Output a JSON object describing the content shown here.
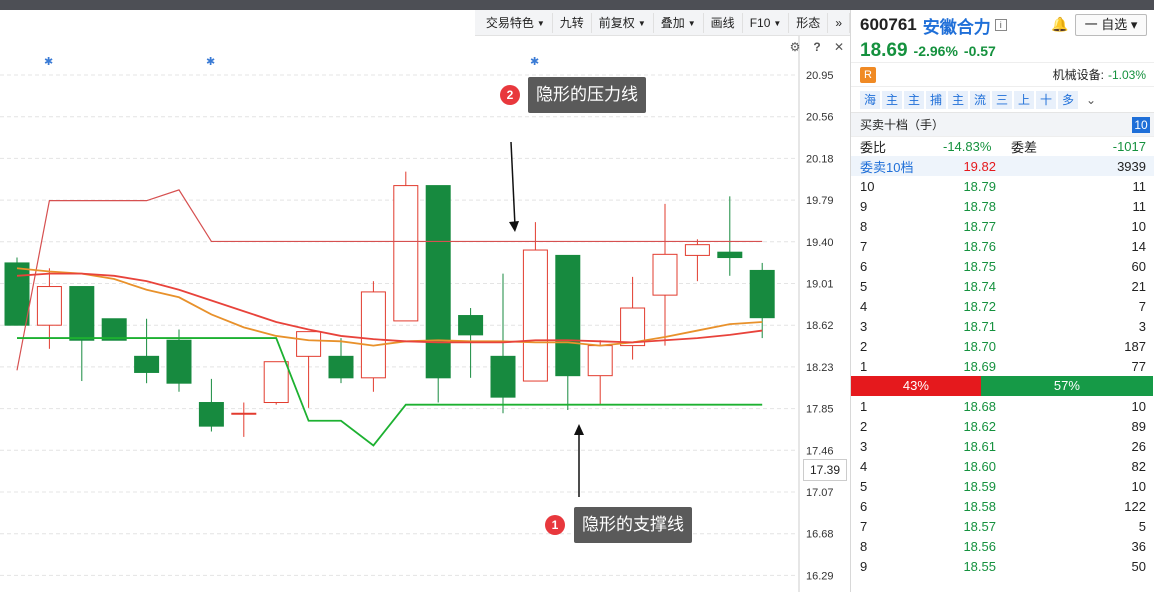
{
  "toolbar": {
    "items": [
      {
        "label": "交易特色",
        "caret": true
      },
      {
        "label": "九转",
        "caret": false
      },
      {
        "label": "前复权",
        "caret": true
      },
      {
        "label": "叠加",
        "caret": true
      },
      {
        "label": "画线",
        "caret": false
      },
      {
        "label": "F10",
        "caret": true
      },
      {
        "label": "形态",
        "caret": false
      },
      {
        "label": "»",
        "caret": false
      }
    ]
  },
  "chart": {
    "y_ticks": [
      "20.95",
      "20.56",
      "20.18",
      "19.79",
      "19.40",
      "19.01",
      "18.62",
      "18.23",
      "17.85",
      "17.46",
      "17.07",
      "16.68",
      "16.29"
    ],
    "current_price_tag": "17.39",
    "callout_resistance": "隐形的压力线",
    "callout_support": "隐形的支撑线",
    "badge_resistance": "2",
    "badge_support": "1",
    "icons": [
      "gear-icon",
      "help-icon",
      "close-icon"
    ],
    "colors": {
      "up": "#e23b2e",
      "down": "#178a3f",
      "ma_orange": "#e8912b",
      "ma_red": "#e8433b",
      "support": "#1db131",
      "resistance": "#d65050"
    }
  },
  "chart_data": {
    "type": "candlestick",
    "candles": [
      {
        "o": 19.2,
        "h": 19.25,
        "l": 18.62,
        "c": 18.62
      },
      {
        "o": 18.62,
        "h": 19.15,
        "l": 18.4,
        "c": 18.98
      },
      {
        "o": 18.98,
        "h": 18.98,
        "l": 18.1,
        "c": 18.48
      },
      {
        "o": 18.68,
        "h": 18.68,
        "l": 18.5,
        "c": 18.48
      },
      {
        "o": 18.33,
        "h": 18.68,
        "l": 18.08,
        "c": 18.18
      },
      {
        "o": 18.48,
        "h": 18.58,
        "l": 18.0,
        "c": 18.08
      },
      {
        "o": 17.9,
        "h": 18.12,
        "l": 17.63,
        "c": 17.68
      },
      {
        "o": 17.8,
        "h": 17.9,
        "l": 17.58,
        "c": 17.8
      },
      {
        "o": 17.9,
        "h": 18.12,
        "l": 17.88,
        "c": 18.28
      },
      {
        "o": 18.33,
        "h": 18.56,
        "l": 17.85,
        "c": 18.56
      },
      {
        "o": 18.33,
        "h": 18.5,
        "l": 18.08,
        "c": 18.13
      },
      {
        "o": 18.13,
        "h": 19.03,
        "l": 18.0,
        "c": 18.93
      },
      {
        "o": 18.66,
        "h": 20.05,
        "l": 18.66,
        "c": 19.92
      },
      {
        "o": 19.92,
        "h": 19.92,
        "l": 17.9,
        "c": 18.13
      },
      {
        "o": 18.71,
        "h": 18.78,
        "l": 18.13,
        "c": 18.53
      },
      {
        "o": 18.33,
        "h": 19.1,
        "l": 17.8,
        "c": 17.95
      },
      {
        "o": 18.1,
        "h": 19.58,
        "l": 18.1,
        "c": 19.32
      },
      {
        "o": 19.27,
        "h": 19.27,
        "l": 17.83,
        "c": 18.15
      },
      {
        "o": 18.15,
        "h": 18.48,
        "l": 17.88,
        "c": 18.43
      },
      {
        "o": 18.43,
        "h": 19.07,
        "l": 18.3,
        "c": 18.78
      },
      {
        "o": 18.9,
        "h": 19.75,
        "l": 18.43,
        "c": 19.28
      },
      {
        "o": 19.27,
        "h": 19.42,
        "l": 19.03,
        "c": 19.37
      },
      {
        "o": 19.3,
        "h": 19.82,
        "l": 19.08,
        "c": 19.25
      },
      {
        "o": 19.13,
        "h": 19.2,
        "l": 18.5,
        "c": 18.69
      }
    ],
    "ma_orange": [
      19.15,
      19.12,
      19.1,
      19.05,
      18.95,
      18.88,
      18.72,
      18.6,
      18.52,
      18.48,
      18.47,
      18.43,
      18.47,
      18.48,
      18.47,
      18.47,
      18.46,
      18.46,
      18.43,
      18.46,
      18.51,
      18.57,
      18.63,
      18.65
    ],
    "ma_red": [
      19.08,
      19.1,
      19.1,
      19.08,
      19.03,
      18.95,
      18.85,
      18.75,
      18.65,
      18.58,
      18.52,
      18.49,
      18.47,
      18.46,
      18.46,
      18.46,
      18.48,
      18.48,
      18.47,
      18.46,
      18.48,
      18.5,
      18.53,
      18.57
    ],
    "support": [
      18.5,
      18.5,
      18.5,
      18.5,
      18.5,
      18.5,
      18.5,
      18.5,
      18.5,
      17.73,
      17.73,
      17.5,
      17.88,
      17.88,
      17.88,
      17.88,
      17.88,
      17.88,
      17.88,
      17.88,
      17.88,
      17.88,
      17.88,
      17.88
    ],
    "resistance": [
      18.2,
      19.78,
      19.78,
      19.78,
      19.78,
      19.88,
      19.4,
      19.4,
      19.4,
      19.4,
      19.4,
      19.4,
      19.4,
      19.4,
      19.4,
      19.4,
      19.4,
      19.4,
      19.4,
      19.4,
      19.4,
      19.4,
      19.4,
      19.4
    ]
  },
  "stock": {
    "code": "600761",
    "name": "安徽合力",
    "info_icon": "i",
    "watch_label": "一 自选",
    "price": "18.69",
    "pct": "-2.96%",
    "chg": "-0.57",
    "r_badge": "R",
    "sector": "机械设备:",
    "sector_chg": "-1.03%"
  },
  "quick_tabs": [
    "海",
    "主",
    "主",
    "捕",
    "主",
    "流",
    "三",
    "上",
    "十",
    "多"
  ],
  "book": {
    "title": "买卖十档（手）",
    "count": "10",
    "ratio_label": "委比",
    "ratio_value": "-14.83%",
    "diff_label": "委差",
    "diff_value": "-1017",
    "sell10_label": "委卖10档",
    "sell10_price": "19.82",
    "sell10_vol": "3939",
    "asks": [
      {
        "lvl": "10",
        "price": "18.79",
        "vol": "11"
      },
      {
        "lvl": "9",
        "price": "18.78",
        "vol": "11"
      },
      {
        "lvl": "8",
        "price": "18.77",
        "vol": "10"
      },
      {
        "lvl": "7",
        "price": "18.76",
        "vol": "14"
      },
      {
        "lvl": "6",
        "price": "18.75",
        "vol": "60"
      },
      {
        "lvl": "5",
        "price": "18.74",
        "vol": "21"
      },
      {
        "lvl": "4",
        "price": "18.72",
        "vol": "7"
      },
      {
        "lvl": "3",
        "price": "18.71",
        "vol": "3"
      },
      {
        "lvl": "2",
        "price": "18.70",
        "vol": "187"
      },
      {
        "lvl": "1",
        "price": "18.69",
        "vol": "77"
      }
    ],
    "bar_red_label": "43%",
    "bar_green_label": "57%",
    "bar_red_frac": 0.43,
    "bids": [
      {
        "lvl": "1",
        "price": "18.68",
        "vol": "10"
      },
      {
        "lvl": "2",
        "price": "18.62",
        "vol": "89"
      },
      {
        "lvl": "3",
        "price": "18.61",
        "vol": "26"
      },
      {
        "lvl": "4",
        "price": "18.60",
        "vol": "82"
      },
      {
        "lvl": "5",
        "price": "18.59",
        "vol": "10"
      },
      {
        "lvl": "6",
        "price": "18.58",
        "vol": "122"
      },
      {
        "lvl": "7",
        "price": "18.57",
        "vol": "5"
      },
      {
        "lvl": "8",
        "price": "18.56",
        "vol": "36"
      },
      {
        "lvl": "9",
        "price": "18.55",
        "vol": "50"
      }
    ]
  }
}
